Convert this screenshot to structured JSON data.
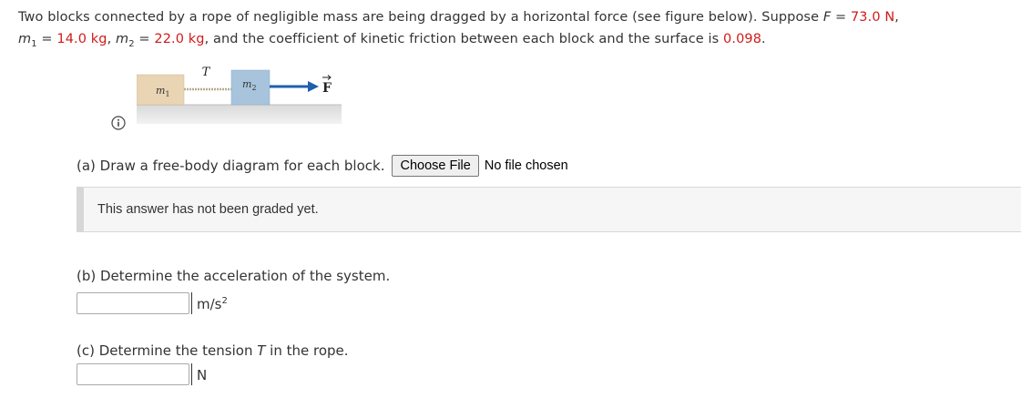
{
  "problem": {
    "line1_pre": "Two blocks connected by a rope of negligible mass are being dragged by a horizontal force (see figure below). Suppose ",
    "F_symbol": "F",
    "equals": " = ",
    "F_value": "73.0 N",
    "comma": ",",
    "m1_symbol": "m",
    "m1_sub": "1",
    "m1_value": "14.0 kg",
    "sep1": ", ",
    "m2_symbol": "m",
    "m2_sub": "2",
    "m2_value": "22.0 kg",
    "line2_mid": ", and the coefficient of kinetic friction between each block and the surface is ",
    "mu_value": "0.098",
    "period": "."
  },
  "figure": {
    "tension_label": "T",
    "block1_label": "m",
    "block1_sub": "1",
    "block2_label": "m",
    "block2_sub": "2",
    "force_label": "F",
    "colors": {
      "block1": "#e9d4b4",
      "block2": "#a8c4dc",
      "surface": "#e4e4e4",
      "arrow": "#1f5fae",
      "rope": "#b8a890"
    }
  },
  "info_icon": "info-icon",
  "part_a": {
    "question": "(a) Draw a free-body diagram for each block.",
    "file_button": "Choose File",
    "file_status": "No file chosen"
  },
  "graded_notice": "This answer has not been graded yet.",
  "part_b": {
    "question": "(b) Determine the acceleration of the system.",
    "value": "",
    "unit": "m/s",
    "unit_sup": "2"
  },
  "part_c": {
    "question_pre": "(c) Determine the tension ",
    "question_var": "T",
    "question_post": " in the rope.",
    "value": "",
    "unit": "N"
  },
  "colors": {
    "highlight": "#d11a1a",
    "text": "#333333"
  }
}
